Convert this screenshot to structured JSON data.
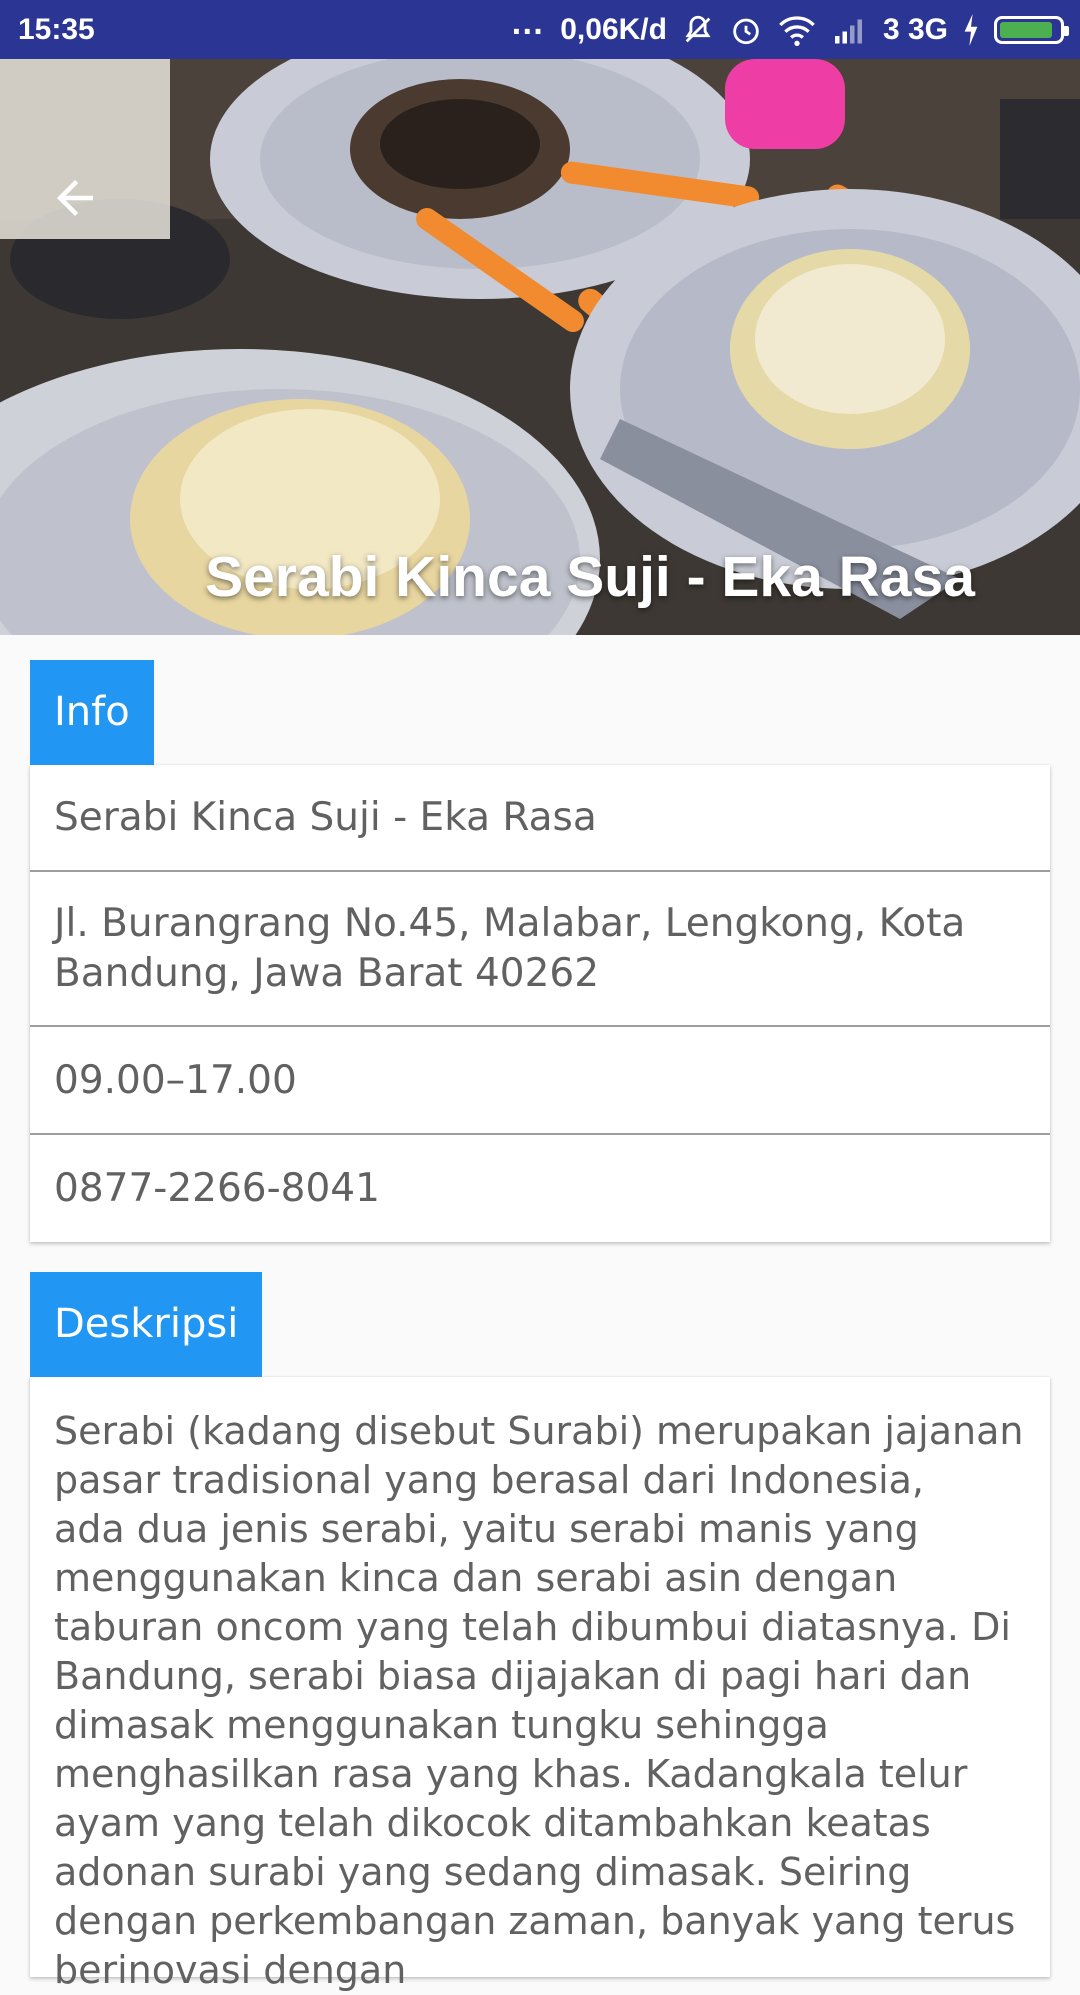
{
  "status_bar": {
    "time": "15:35",
    "network_speed": "0,06K/d",
    "signal_text": "3 3G",
    "battery_level": 0.9,
    "icons": [
      "more-dots-icon",
      "mute-icon",
      "alarm-icon",
      "wifi-icon",
      "signal-icon",
      "charging-icon",
      "battery-icon"
    ]
  },
  "header": {
    "title": "Serabi Kinca Suji - Eka Rasa",
    "back_icon": "arrow-back-icon"
  },
  "info": {
    "tab_label": "Info",
    "name": "Serabi Kinca Suji - Eka Rasa",
    "address": "Jl. Burangrang No.45, Malabar, Lengkong, Kota Bandung, Jawa Barat 40262",
    "hours": "09.00–17.00",
    "phone": "0877-2266-8041"
  },
  "description": {
    "tab_label": "Deskripsi",
    "text": "Serabi (kadang disebut Surabi) merupakan jajanan pasar tradisional yang berasal dari Indonesia,\nada dua jenis serabi, yaitu serabi manis yang menggunakan kinca dan serabi asin dengan taburan oncom yang telah dibumbui diatasnya. Di Bandung, serabi biasa dijajakan di pagi hari dan dimasak menggunakan tungku sehingga menghasilkan rasa yang khas. Kadangkala telur ayam yang telah dikocok ditambahkan keatas adonan surabi yang sedang dimasak. Seiring dengan perkembangan zaman, banyak yang terus berinovasi dengan"
  },
  "colors": {
    "status_bar": "#2b3593",
    "accent": "#2196f3",
    "battery": "#4caf50"
  }
}
